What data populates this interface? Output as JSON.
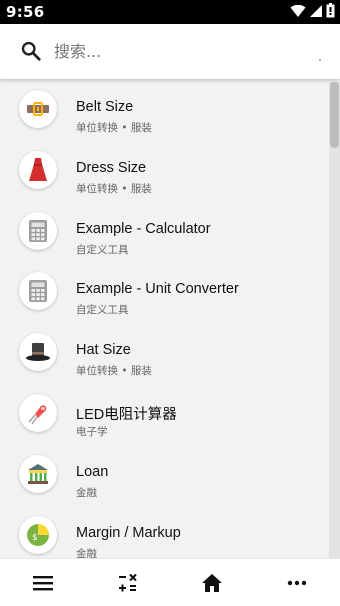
{
  "status_bar": {
    "time": "9:56",
    "icons": [
      "wifi-icon",
      "cell-signal-icon",
      "battery-icon"
    ]
  },
  "search": {
    "placeholder": "搜索..."
  },
  "list": {
    "items": [
      {
        "title": "Belt Size",
        "subtitle": "单位转换 • 服装",
        "icon": "belt-icon"
      },
      {
        "title": "Dress Size",
        "subtitle": "单位转换 • 服装",
        "icon": "dress-icon"
      },
      {
        "title": "Example - Calculator",
        "subtitle": "自定义工具",
        "icon": "calculator-icon"
      },
      {
        "title": "Example - Unit Converter",
        "subtitle": "自定义工具",
        "icon": "calculator-icon"
      },
      {
        "title": "Hat Size",
        "subtitle": "单位转换 • 服装",
        "icon": "top-hat-icon"
      },
      {
        "title": "LED电阻计算器",
        "subtitle": "电子学",
        "icon": "led-icon"
      },
      {
        "title": "Loan",
        "subtitle": "金融",
        "icon": "bank-icon"
      },
      {
        "title": "Margin / Markup",
        "subtitle": "金融",
        "icon": "margin-chart-icon"
      }
    ]
  },
  "bottom_nav": {
    "items": [
      "menu-icon",
      "calculator-ops-icon",
      "home-icon",
      "more-icon"
    ]
  },
  "colors": {
    "status_bar": "#000000",
    "background": "#f2f2f2",
    "surface": "#ffffff",
    "dress_red": "#d32f2f",
    "bank_green": "#4caf50"
  }
}
